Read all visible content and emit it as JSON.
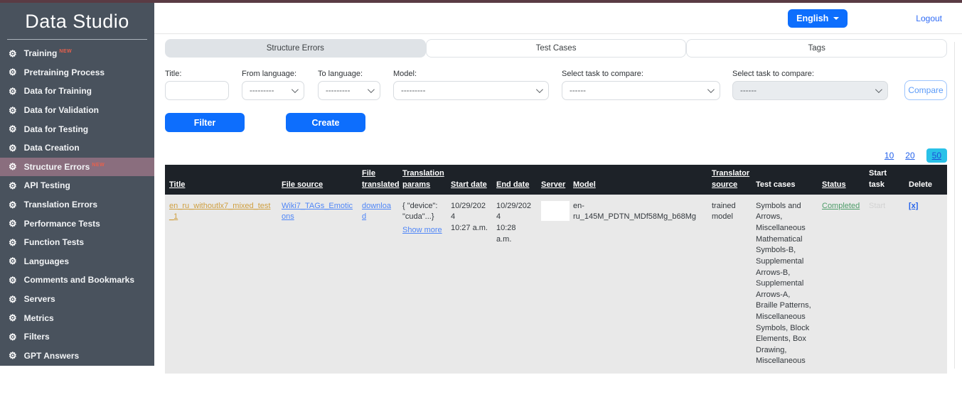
{
  "app": {
    "title": "Data Studio"
  },
  "topbar": {
    "language": "English",
    "logout": "Logout"
  },
  "sidebar": {
    "items": [
      {
        "label": "Training",
        "badge": "new"
      },
      {
        "label": "Pretraining Process",
        "badge": ""
      },
      {
        "label": "Data for Training",
        "badge": ""
      },
      {
        "label": "Data for Validation",
        "badge": ""
      },
      {
        "label": "Data for Testing",
        "badge": ""
      },
      {
        "label": "Data Creation",
        "badge": ""
      },
      {
        "label": "Structure Errors",
        "badge": "new"
      },
      {
        "label": "API Testing",
        "badge": ""
      },
      {
        "label": "Translation Errors",
        "badge": ""
      },
      {
        "label": "Performance Tests",
        "badge": ""
      },
      {
        "label": "Function Tests",
        "badge": ""
      },
      {
        "label": "Languages",
        "badge": ""
      },
      {
        "label": "Comments and Bookmarks",
        "badge": ""
      },
      {
        "label": "Servers",
        "badge": ""
      },
      {
        "label": "Metrics",
        "badge": ""
      },
      {
        "label": "Filters",
        "badge": ""
      },
      {
        "label": "GPT Answers",
        "badge": ""
      }
    ]
  },
  "tabs": [
    {
      "label": "Structure Errors",
      "active": true
    },
    {
      "label": "Test Cases",
      "active": false
    },
    {
      "label": "Tags",
      "active": false
    }
  ],
  "filters": {
    "title_label": "Title:",
    "from_language_label": "From language:",
    "from_language_value": "---------",
    "to_language_label": "To language:",
    "to_language_value": "---------",
    "model_label": "Model:",
    "model_value": "---------",
    "task1_label": "Select task to compare:",
    "task1_value": "------",
    "task2_label": "Select task to compare:",
    "task2_value": "------",
    "compare_button": "Compare"
  },
  "actions": {
    "filter_button": "Filter",
    "create_button": "Create"
  },
  "pagination": {
    "options": [
      "10",
      "20",
      "50"
    ],
    "selected": "50"
  },
  "table": {
    "headers": [
      {
        "label": "Title",
        "sortable": true
      },
      {
        "label": "File source",
        "sortable": true
      },
      {
        "label": "File translated",
        "sortable": true
      },
      {
        "label": "Translation params",
        "sortable": true
      },
      {
        "label": "Start date",
        "sortable": true
      },
      {
        "label": "End date",
        "sortable": true
      },
      {
        "label": "Server",
        "sortable": true
      },
      {
        "label": "Model",
        "sortable": true
      },
      {
        "label": "Translator source",
        "sortable": true
      },
      {
        "label": "Test cases",
        "sortable": false
      },
      {
        "label": "Status",
        "sortable": true
      },
      {
        "label": "Start task",
        "sortable": false
      },
      {
        "label": "Delete",
        "sortable": false
      }
    ],
    "row": {
      "title": "en_ru_withoutlx7_mixed_test_1",
      "file_source": "Wiki7_TAGs_Emoticons",
      "file_translated": "download",
      "translation_params": "{ \"device\": \"cuda\"...}",
      "show_more": "Show more",
      "start_date": "10/29/2024",
      "start_time": "10:27 a.m.",
      "end_date": "10/29/2024",
      "end_time": "10:28 a.m.",
      "model": "en-ru_145M_PDTN_MDf58Mg_b68Mg",
      "translator_source": "trained model",
      "test_cases": "Symbols and Arrows, Miscellaneous Mathematical Symbols-B, Supplemental Arrows-B, Supplemental Arrows-A, Braille Patterns, Miscellaneous Symbols, Block Elements, Box Drawing, Miscellaneous",
      "status": "Completed",
      "start_task": "Start",
      "delete": "[x]"
    }
  },
  "colors": {
    "accent_blue": "#0d6efd",
    "top_strip": "#5a3b44",
    "sidebar_bg": "#49525d",
    "sidebar_active_bg": "#8a6e7e",
    "table_header_bg": "#1d2228",
    "row_bg": "#e9e9e9",
    "pagination_selected_bg": "#29c1e8",
    "title_link": "#cf9f3f",
    "status_green": "#4e9d69"
  }
}
